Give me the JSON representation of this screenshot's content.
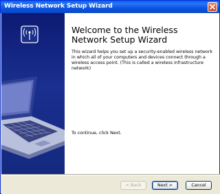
{
  "window": {
    "title": "Wireless Network Setup Wizard"
  },
  "content": {
    "heading": "Welcome to the Wireless Network Setup Wizard",
    "description": "This wizard helps you set up a security-enabled wireless network in which all of your computers and devices connect through a wireless access point. (This is called a wireless infrastructure network)",
    "continue_hint": "To continue, click Next."
  },
  "buttons": {
    "back": "< Back",
    "next": "Next >",
    "cancel": "Cancel"
  },
  "colors": {
    "titlebar": "#0a55e0",
    "side_panel": "#14297f",
    "close_button": "#c7401c"
  },
  "icons": {
    "wizard": "wireless-antenna-icon",
    "illustration": "laptop-illustration",
    "close": "close-icon"
  }
}
